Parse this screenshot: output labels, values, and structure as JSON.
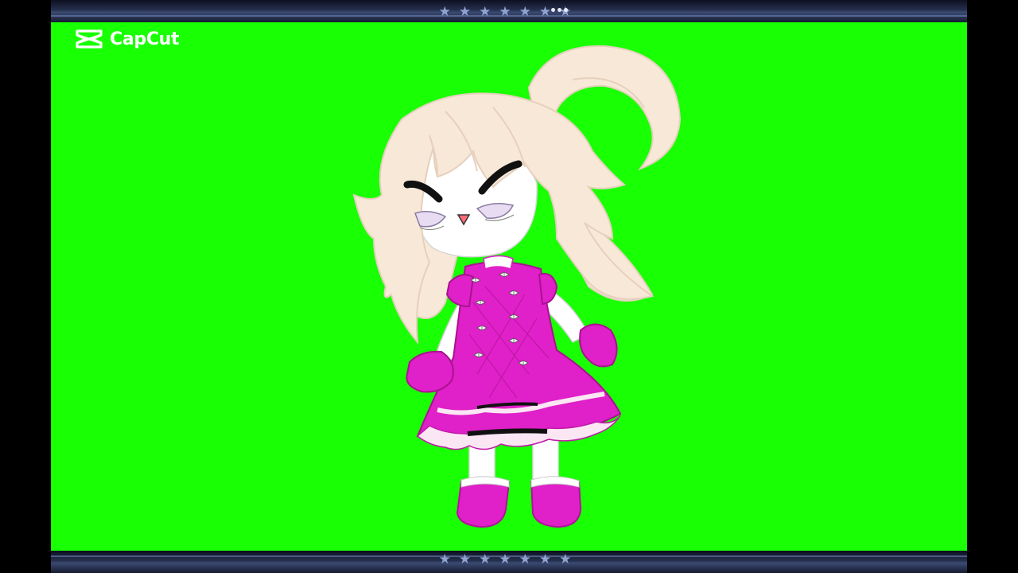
{
  "watermark": {
    "icon": "capcut-logo-icon",
    "text": "CapCut"
  },
  "frame": {
    "top_bar_icon": "more-dots-icon",
    "star_decoration": "star-icon",
    "star_count_per_side": 7
  },
  "background": {
    "color": "#19ff04"
  },
  "colors": {
    "hair": "#f8e8d8",
    "dress": "#e020c8",
    "skin": "#ffffff",
    "bar": "#26304f"
  }
}
